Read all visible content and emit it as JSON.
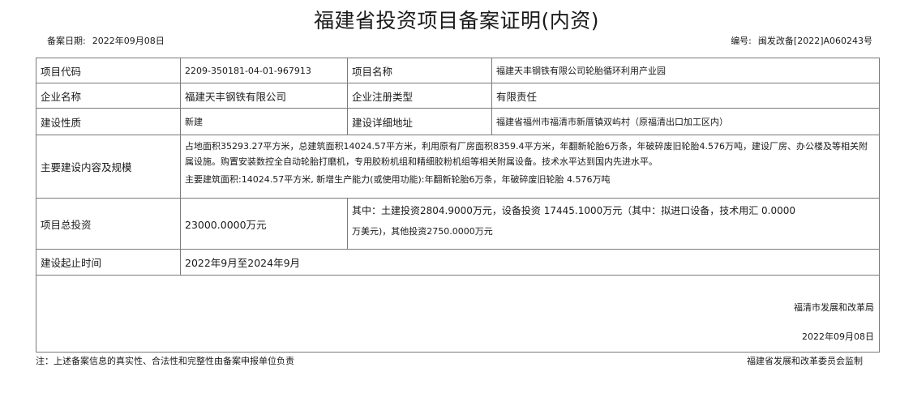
{
  "document": {
    "title": "福建省投资项目备案证明(内资)",
    "filing_date_label": "备案日期:",
    "filing_date": "2022年09月08日",
    "number_label": "编号:",
    "number": "闽发改备[2022]A060243号"
  },
  "table": {
    "project_code_label": "项目代码",
    "project_code": "2209-350181-04-01-967913",
    "project_name_label": "项目名称",
    "project_name": "福建天丰钢铁有限公司轮胎循环利用产业园",
    "company_name_label": "企业名称",
    "company_name": "福建天丰钢铁有限公司",
    "company_type_label": "企业注册类型",
    "company_type": "有限责任",
    "construction_nature_label": "建设性质",
    "construction_nature": "新建",
    "address_label": "建设详细地址",
    "address": "福建省福州市福清市新厝镇双屿村（原福清出口加工区内）",
    "scope_label": "主要建设内容及规模",
    "scope_line1": "占地面积35293.27平方米，总建筑面积14024.57平方米，利用原有厂房面积8359.4平方米，年翻新轮胎6万条，年破碎废旧轮胎4.576万吨，建设厂房、办公楼及等相关附",
    "scope_line2": "属设施。购置安装数控全自动轮胎打磨机，专用胶粉机组和精细胶粉机组等相关附属设备。技术水平达到国内先进水平。",
    "scope_line3": "主要建筑面积:14024.57平方米, 新增生产能力(或使用功能):年翻新轮胎6万条，年破碎废旧轮胎 4.576万吨",
    "investment_label": "项目总投资",
    "investment_total": "23000.0000万元",
    "investment_detail_line1": "其中：土建投资2804.9000万元，设备投资 17445.1000万元（其中：拟进口设备，技术用汇 0.0000",
    "investment_detail_line2": "万美元)，其他投资2750.0000万元",
    "period_label": "建设起止时间",
    "period": "2022年9月至2024年9月"
  },
  "signature": {
    "authority": "福清市发展和改革局",
    "date": "2022年09月08日"
  },
  "footer": {
    "note": "注：上述备案信息的真实性、合法性和完整性由备案申报单位负责",
    "supervise": "福建省发展和改革委员会监制"
  }
}
